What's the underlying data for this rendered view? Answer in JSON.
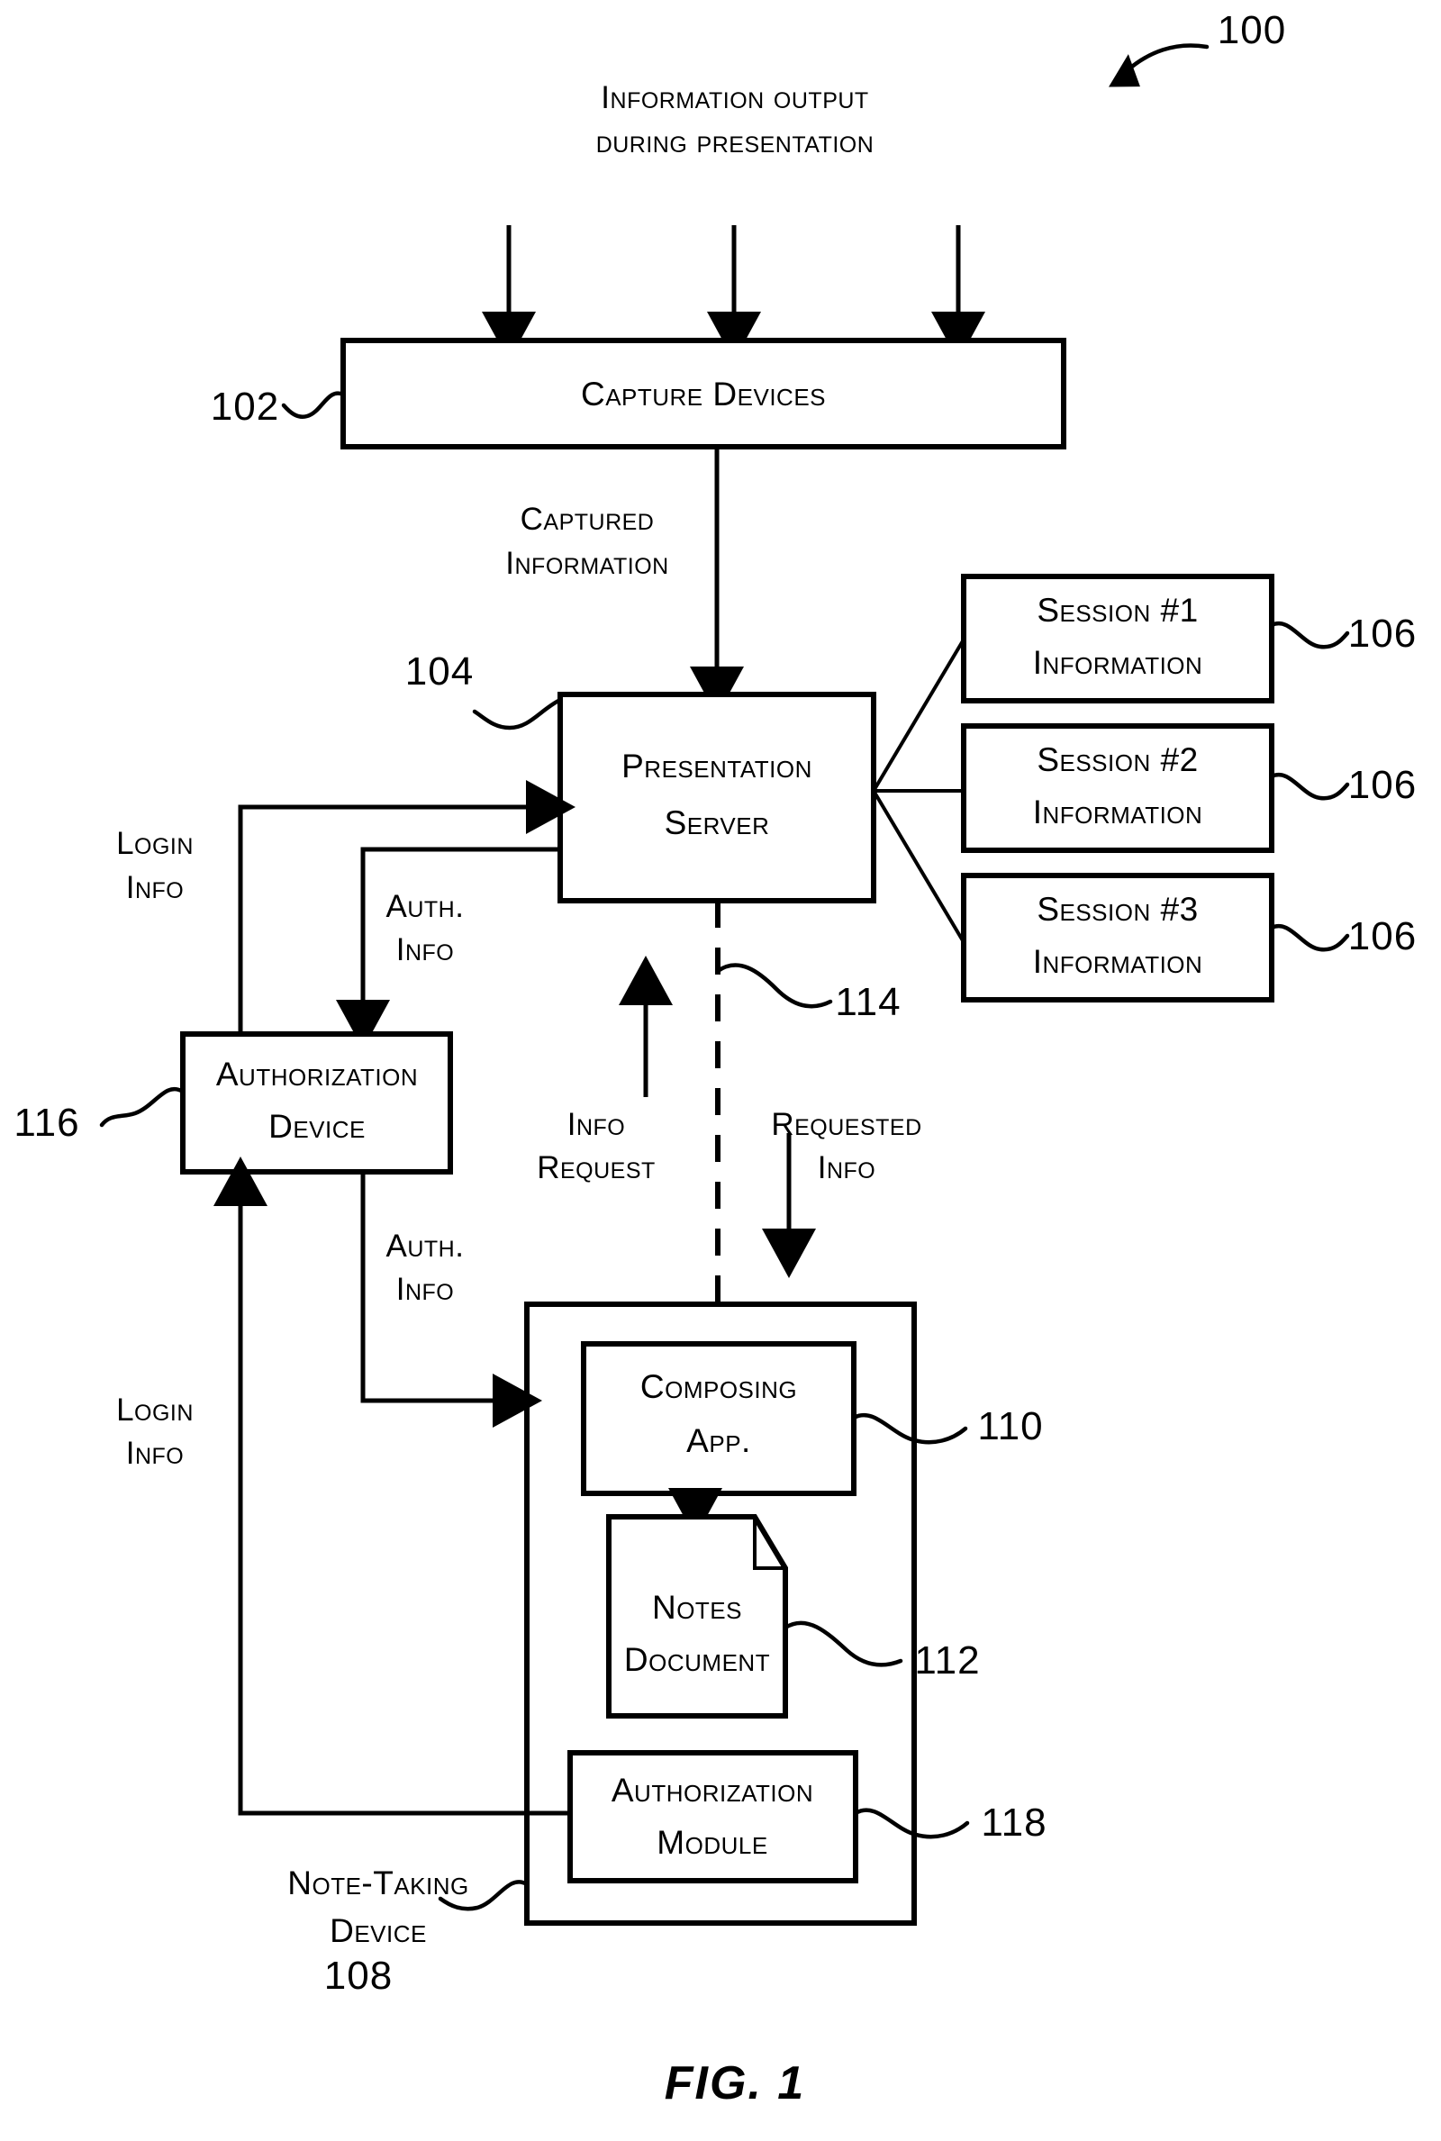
{
  "figure": {
    "caption": "FIG. 1",
    "system_numeral": "100"
  },
  "inputs": {
    "top_label_line1": "Information output",
    "top_label_line2": "during  presentation",
    "arrow_count": 3
  },
  "boxes": {
    "capture_devices": {
      "label": "Capture Devices",
      "numeral": "102"
    },
    "presentation_server": {
      "label_line1": "Presentation",
      "label_line2": "Server",
      "numeral": "104"
    },
    "session1": {
      "label_line1": "Session #1",
      "label_line2": "Information",
      "numeral": "106"
    },
    "session2": {
      "label_line1": "Session #2",
      "label_line2": "Information",
      "numeral": "106"
    },
    "session3": {
      "label_line1": "Session #3",
      "label_line2": "Information",
      "numeral": "106"
    },
    "authorization_device": {
      "label_line1": "Authorization",
      "label_line2": "Device",
      "numeral": "116"
    },
    "note_taking_device": {
      "label_line1": "Note-Taking",
      "label_line2": "Device",
      "numeral": "108"
    },
    "composing_app": {
      "label_line1": "Composing",
      "label_line2": "App.",
      "numeral": "110"
    },
    "notes_document": {
      "label_line1": "Notes",
      "label_line2": "Document",
      "numeral": "112"
    },
    "authorization_module": {
      "label_line1": "Authorization",
      "label_line2": "Module",
      "numeral": "118"
    }
  },
  "flows": {
    "captured_information": {
      "line1": "Captured",
      "line2": "Information"
    },
    "login_info_server": {
      "line1": "Login",
      "line2": "Info"
    },
    "auth_info_to_device": {
      "line1": "Auth.",
      "line2": "Info"
    },
    "auth_info_to_module": {
      "line1": "Auth.",
      "line2": "Info"
    },
    "login_info_module": {
      "line1": "Login",
      "line2": "Info"
    },
    "info_request": {
      "line1": "Info",
      "line2": "Request"
    },
    "requested_info": {
      "line1": "Requested",
      "line2": "Info"
    },
    "network_link": {
      "numeral": "114"
    }
  },
  "colors": {
    "ink": "#000000",
    "paper": "#ffffff"
  }
}
